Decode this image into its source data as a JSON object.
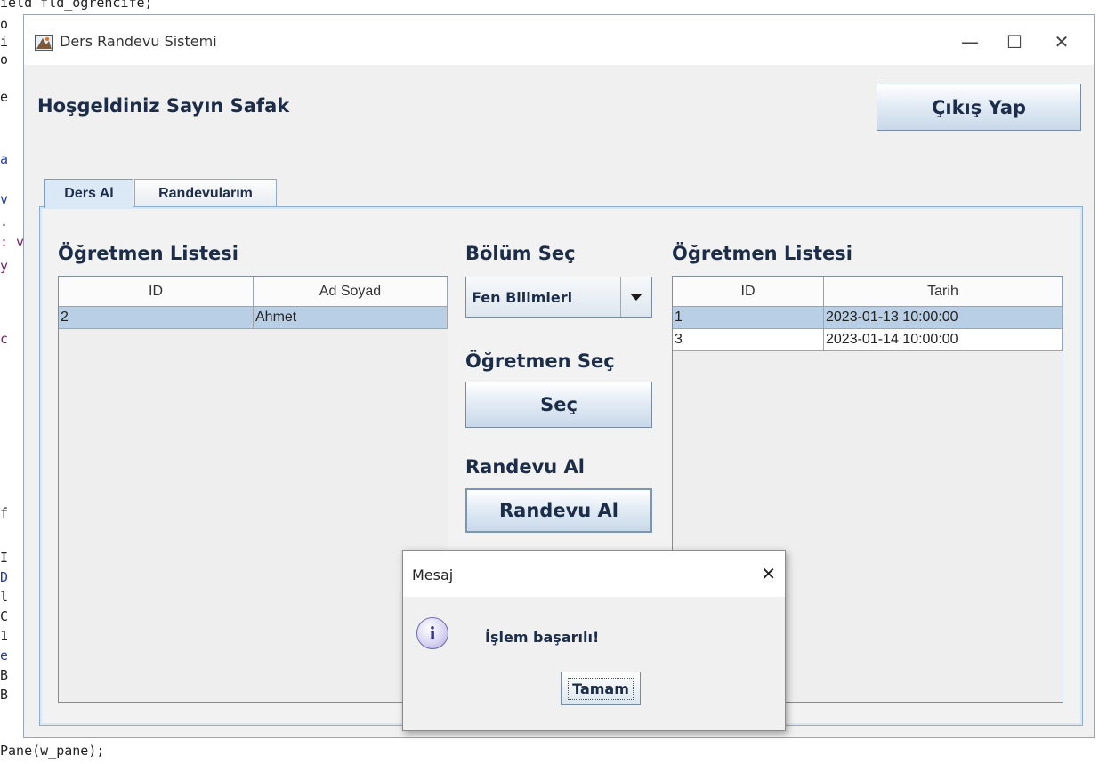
{
  "background_code": {
    "lines": [
      {
        "text": "ield fld_ogrencife;"
      },
      {
        "text": "o"
      },
      {
        "text": "i"
      },
      {
        "text": "o"
      },
      {
        "text": "e"
      },
      {
        "text": "a"
      },
      {
        "text": "v"
      },
      {
        "text": "."
      },
      {
        "text": ": v"
      },
      {
        "text": "y"
      },
      {
        "text": "c"
      },
      {
        "text": "f"
      },
      {
        "text": "I"
      },
      {
        "text": "D"
      },
      {
        "text": "l"
      },
      {
        "text": "C"
      },
      {
        "text": "1"
      },
      {
        "text": "e"
      },
      {
        "text": "B"
      },
      {
        "text": "B"
      },
      {
        "text": "Pane(w_pane);"
      }
    ]
  },
  "window": {
    "title": "Ders Randevu Sistemi",
    "controls": {
      "minimize": "—",
      "maximize": "☐",
      "close": "✕"
    }
  },
  "header": {
    "welcome": "Hoşgeldiniz Sayın Safak",
    "logout_label": "Çıkış Yap"
  },
  "tabs": [
    {
      "label": "Ders Al",
      "selected": true
    },
    {
      "label": "Randevularım",
      "selected": false
    }
  ],
  "left_panel": {
    "title": "Öğretmen Listesi",
    "columns": [
      "ID",
      "Ad Soyad"
    ],
    "rows": [
      {
        "cells": [
          "2",
          "Ahmet"
        ],
        "selected": true
      }
    ]
  },
  "middle_panel": {
    "bolum_title": "Bölüm Seç",
    "bolum_value": "Fen Bilimleri",
    "ogretmen_title": "Öğretmen Seç",
    "sec_label": "Seç",
    "randevu_title": "Randevu Al",
    "randevu_button": "Randevu Al"
  },
  "right_panel": {
    "title": "Öğretmen Listesi",
    "columns": [
      "ID",
      "Tarih"
    ],
    "rows": [
      {
        "cells": [
          "1",
          "2023-01-13 10:00:00"
        ],
        "selected": true
      },
      {
        "cells": [
          "3",
          "2023-01-14 10:00:00"
        ],
        "selected": false
      }
    ]
  },
  "dialog": {
    "title": "Mesaj",
    "close": "✕",
    "icon": "info-icon",
    "message": "İşlem başarılı!",
    "ok_label": "Tamam"
  },
  "colors": {
    "text_primary": "#1c2d4a",
    "selection": "#b8cfe5",
    "panel_border": "#8fb0d6"
  }
}
